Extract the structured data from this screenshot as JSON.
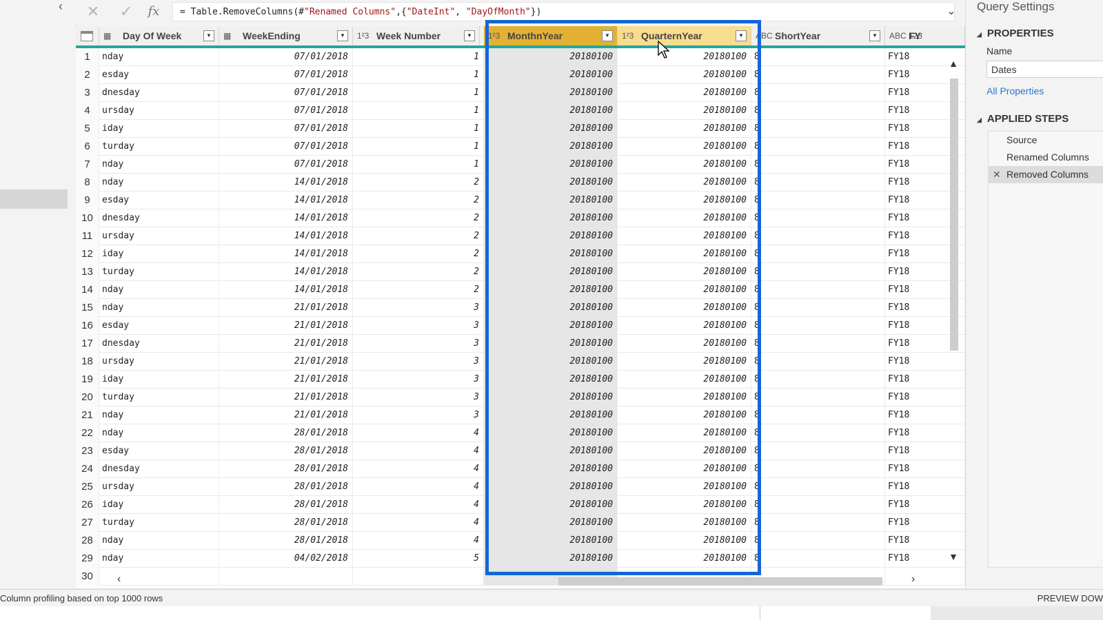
{
  "formula": {
    "prefix": "= Table.RemoveColumns(#",
    "s1": "\"Renamed Columns\"",
    "mid": ",{",
    "s2": "\"DateInt\"",
    "sep": ", ",
    "s3": "\"DayOfMonth\"",
    "suffix": "})"
  },
  "columns": [
    {
      "label": "Day Of Week",
      "type_icon": "calendar-icon"
    },
    {
      "label": "WeekEnding",
      "type_icon": "calendar-icon"
    },
    {
      "label": "Week Number",
      "type_icon": "1²3"
    },
    {
      "label": "MonthnYear",
      "type_icon": "1²3"
    },
    {
      "label": "QuarternYear",
      "type_icon": "1²3"
    },
    {
      "label": "ShortYear",
      "type_icon": "ABC"
    },
    {
      "label": "FY",
      "type_icon": "ABC 123"
    }
  ],
  "rows": [
    {
      "n": "1",
      "dow": "nday",
      "we": "07/01/2018",
      "wn": "1",
      "my": "20180100",
      "qy": "20180100",
      "sy": "8",
      "fy": "FY18"
    },
    {
      "n": "2",
      "dow": "esday",
      "we": "07/01/2018",
      "wn": "1",
      "my": "20180100",
      "qy": "20180100",
      "sy": "8",
      "fy": "FY18"
    },
    {
      "n": "3",
      "dow": "dnesday",
      "we": "07/01/2018",
      "wn": "1",
      "my": "20180100",
      "qy": "20180100",
      "sy": "8",
      "fy": "FY18"
    },
    {
      "n": "4",
      "dow": "ursday",
      "we": "07/01/2018",
      "wn": "1",
      "my": "20180100",
      "qy": "20180100",
      "sy": "8",
      "fy": "FY18"
    },
    {
      "n": "5",
      "dow": "iday",
      "we": "07/01/2018",
      "wn": "1",
      "my": "20180100",
      "qy": "20180100",
      "sy": "8",
      "fy": "FY18"
    },
    {
      "n": "6",
      "dow": "turday",
      "we": "07/01/2018",
      "wn": "1",
      "my": "20180100",
      "qy": "20180100",
      "sy": "8",
      "fy": "FY18"
    },
    {
      "n": "7",
      "dow": "nday",
      "we": "07/01/2018",
      "wn": "1",
      "my": "20180100",
      "qy": "20180100",
      "sy": "8",
      "fy": "FY18"
    },
    {
      "n": "8",
      "dow": "nday",
      "we": "14/01/2018",
      "wn": "2",
      "my": "20180100",
      "qy": "20180100",
      "sy": "8",
      "fy": "FY18"
    },
    {
      "n": "9",
      "dow": "esday",
      "we": "14/01/2018",
      "wn": "2",
      "my": "20180100",
      "qy": "20180100",
      "sy": "8",
      "fy": "FY18"
    },
    {
      "n": "10",
      "dow": "dnesday",
      "we": "14/01/2018",
      "wn": "2",
      "my": "20180100",
      "qy": "20180100",
      "sy": "8",
      "fy": "FY18"
    },
    {
      "n": "11",
      "dow": "ursday",
      "we": "14/01/2018",
      "wn": "2",
      "my": "20180100",
      "qy": "20180100",
      "sy": "8",
      "fy": "FY18"
    },
    {
      "n": "12",
      "dow": "iday",
      "we": "14/01/2018",
      "wn": "2",
      "my": "20180100",
      "qy": "20180100",
      "sy": "8",
      "fy": "FY18"
    },
    {
      "n": "13",
      "dow": "turday",
      "we": "14/01/2018",
      "wn": "2",
      "my": "20180100",
      "qy": "20180100",
      "sy": "8",
      "fy": "FY18"
    },
    {
      "n": "14",
      "dow": "nday",
      "we": "14/01/2018",
      "wn": "2",
      "my": "20180100",
      "qy": "20180100",
      "sy": "8",
      "fy": "FY18"
    },
    {
      "n": "15",
      "dow": "nday",
      "we": "21/01/2018",
      "wn": "3",
      "my": "20180100",
      "qy": "20180100",
      "sy": "8",
      "fy": "FY18"
    },
    {
      "n": "16",
      "dow": "esday",
      "we": "21/01/2018",
      "wn": "3",
      "my": "20180100",
      "qy": "20180100",
      "sy": "8",
      "fy": "FY18"
    },
    {
      "n": "17",
      "dow": "dnesday",
      "we": "21/01/2018",
      "wn": "3",
      "my": "20180100",
      "qy": "20180100",
      "sy": "8",
      "fy": "FY18"
    },
    {
      "n": "18",
      "dow": "ursday",
      "we": "21/01/2018",
      "wn": "3",
      "my": "20180100",
      "qy": "20180100",
      "sy": "8",
      "fy": "FY18"
    },
    {
      "n": "19",
      "dow": "iday",
      "we": "21/01/2018",
      "wn": "3",
      "my": "20180100",
      "qy": "20180100",
      "sy": "8",
      "fy": "FY18"
    },
    {
      "n": "20",
      "dow": "turday",
      "we": "21/01/2018",
      "wn": "3",
      "my": "20180100",
      "qy": "20180100",
      "sy": "8",
      "fy": "FY18"
    },
    {
      "n": "21",
      "dow": "nday",
      "we": "21/01/2018",
      "wn": "3",
      "my": "20180100",
      "qy": "20180100",
      "sy": "8",
      "fy": "FY18"
    },
    {
      "n": "22",
      "dow": "nday",
      "we": "28/01/2018",
      "wn": "4",
      "my": "20180100",
      "qy": "20180100",
      "sy": "8",
      "fy": "FY18"
    },
    {
      "n": "23",
      "dow": "esday",
      "we": "28/01/2018",
      "wn": "4",
      "my": "20180100",
      "qy": "20180100",
      "sy": "8",
      "fy": "FY18"
    },
    {
      "n": "24",
      "dow": "dnesday",
      "we": "28/01/2018",
      "wn": "4",
      "my": "20180100",
      "qy": "20180100",
      "sy": "8",
      "fy": "FY18"
    },
    {
      "n": "25",
      "dow": "ursday",
      "we": "28/01/2018",
      "wn": "4",
      "my": "20180100",
      "qy": "20180100",
      "sy": "8",
      "fy": "FY18"
    },
    {
      "n": "26",
      "dow": "iday",
      "we": "28/01/2018",
      "wn": "4",
      "my": "20180100",
      "qy": "20180100",
      "sy": "8",
      "fy": "FY18"
    },
    {
      "n": "27",
      "dow": "turday",
      "we": "28/01/2018",
      "wn": "4",
      "my": "20180100",
      "qy": "20180100",
      "sy": "8",
      "fy": "FY18"
    },
    {
      "n": "28",
      "dow": "nday",
      "we": "28/01/2018",
      "wn": "4",
      "my": "20180100",
      "qy": "20180100",
      "sy": "8",
      "fy": "FY18"
    },
    {
      "n": "29",
      "dow": "nday",
      "we": "04/02/2018",
      "wn": "5",
      "my": "20180100",
      "qy": "20180100",
      "sy": "8",
      "fy": "FY18"
    },
    {
      "n": "30",
      "dow": "",
      "we": "",
      "wn": "",
      "my": "",
      "qy": "",
      "sy": "",
      "fy": ""
    }
  ],
  "settings": {
    "title": "Query Settings",
    "properties_header": "PROPERTIES",
    "name_label": "Name",
    "name_value": "Dates",
    "all_properties": "All Properties",
    "applied_steps_header": "APPLIED STEPS",
    "steps": [
      "Source",
      "Renamed Columns",
      "Removed Columns"
    ]
  },
  "status": {
    "left": "Column profiling based on top 1000 rows",
    "right": "PREVIEW DOW"
  },
  "colors": {
    "highlight_box": "#1565d8",
    "selected_header": "#e3b132",
    "hover_header": "#f7dd8e",
    "header_underline": "#1fa7a0"
  }
}
